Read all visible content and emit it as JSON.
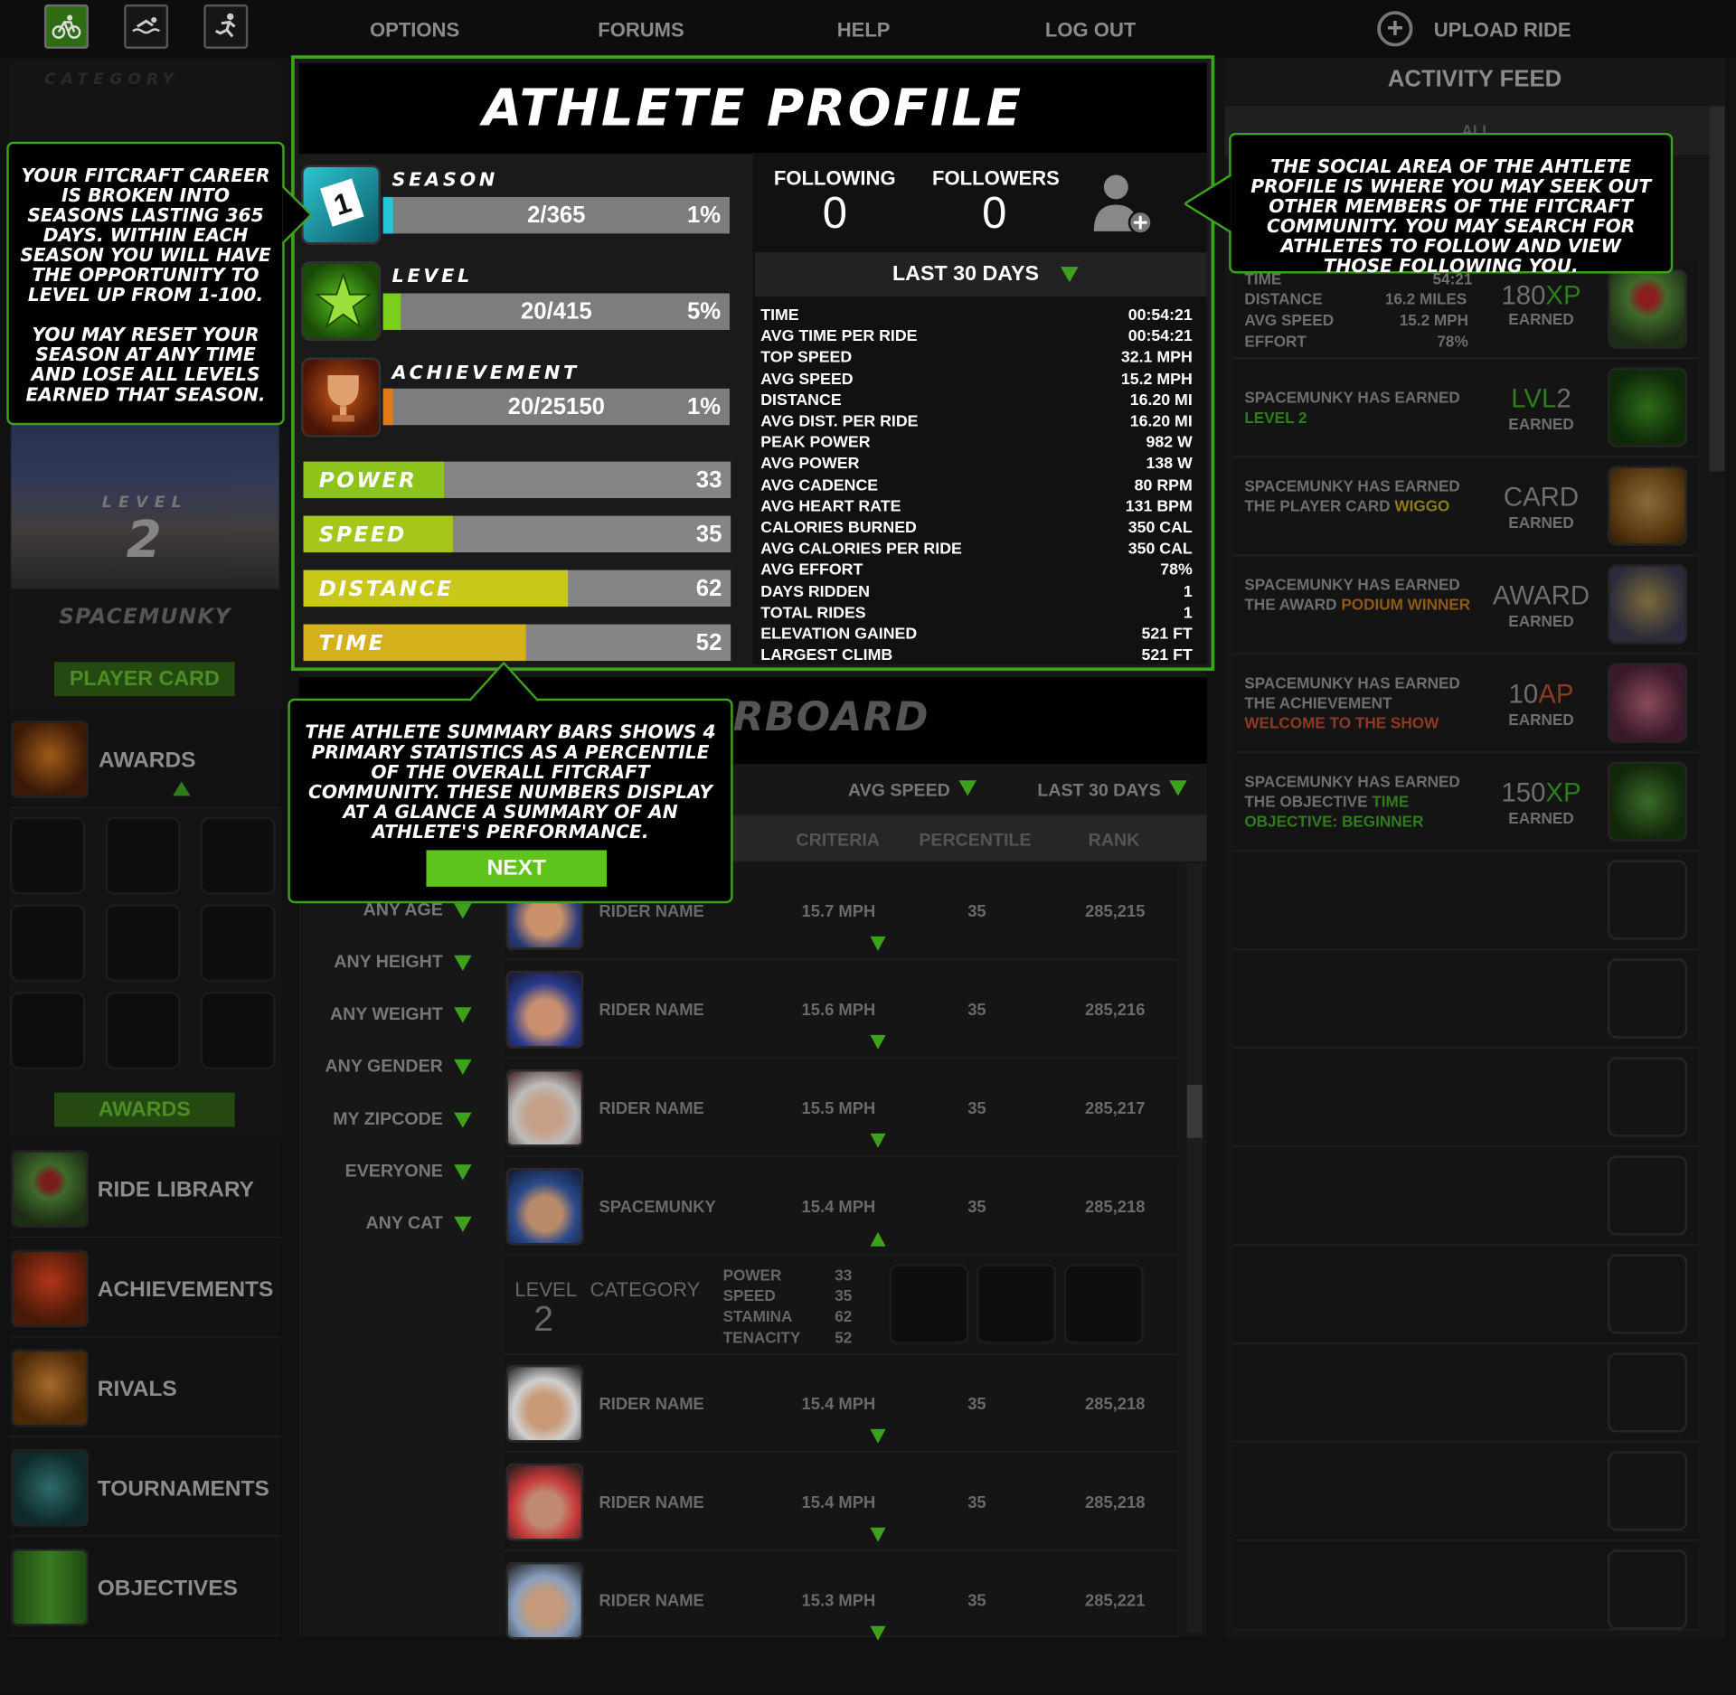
{
  "nav": {
    "options": "OPTIONS",
    "forums": "FORUMS",
    "help": "HELP",
    "logout": "LOG OUT",
    "upload": "UPLOAD RIDE"
  },
  "sidebar": {
    "category_label": "CATEGORY",
    "level_label": "LEVEL",
    "level_value": "2",
    "username": "SPACEMUNKY",
    "player_card_button": "PLAYER CARD",
    "awards_label": "AWARDS",
    "awards_button": "AWARDS",
    "items": [
      {
        "label": "RIDE LIBRARY"
      },
      {
        "label": "ACHIEVEMENTS"
      },
      {
        "label": "RIVALS"
      },
      {
        "label": "TOURNAMENTS"
      },
      {
        "label": "OBJECTIVES"
      }
    ]
  },
  "profile": {
    "title": "ATHLETE PROFILE",
    "season": {
      "label": "SEASON",
      "value": "2/365",
      "pct": "1%",
      "fraction": 0.01,
      "color": "#26c4d8"
    },
    "level": {
      "label": "LEVEL",
      "value": "20/415",
      "pct": "5%",
      "fraction": 0.05,
      "color": "#7bcf1c"
    },
    "achievement": {
      "label": "ACHIEVEMENT",
      "value": "20/25150",
      "pct": "1%",
      "fraction": 0.01,
      "color": "#e07a15"
    },
    "stats": [
      {
        "label": "POWER",
        "value": "33",
        "fraction": 0.33,
        "color": "#8cc41c"
      },
      {
        "label": "SPEED",
        "value": "35",
        "fraction": 0.35,
        "color": "#a6c61a"
      },
      {
        "label": "DISTANCE",
        "value": "62",
        "fraction": 0.62,
        "color": "#c8c81a"
      },
      {
        "label": "TIME",
        "value": "52",
        "fraction": 0.52,
        "color": "#d4b01a"
      }
    ],
    "following_label": "FOLLOWING",
    "following_value": "0",
    "followers_label": "FOLLOWERS",
    "followers_value": "0",
    "period": "LAST 30 DAYS",
    "details": [
      {
        "k": "TIME",
        "v": "00:54:21"
      },
      {
        "k": "AVG TIME PER RIDE",
        "v": "00:54:21"
      },
      {
        "k": "TOP SPEED",
        "v": "32.1 MPH"
      },
      {
        "k": "AVG SPEED",
        "v": "15.2 MPH"
      },
      {
        "k": "DISTANCE",
        "v": "16.20 MI"
      },
      {
        "k": "AVG DIST. PER RIDE",
        "v": "16.20 MI"
      },
      {
        "k": "PEAK POWER",
        "v": "982 W"
      },
      {
        "k": "AVG POWER",
        "v": "138 W"
      },
      {
        "k": "AVG CADENCE",
        "v": "80 RPM"
      },
      {
        "k": "AVG HEART RATE",
        "v": "131 BPM"
      },
      {
        "k": "CALORIES BURNED",
        "v": "350 CAL"
      },
      {
        "k": "AVG CALORIES PER RIDE",
        "v": "350 CAL"
      },
      {
        "k": "AVG EFFORT",
        "v": "78%"
      },
      {
        "k": "DAYS RIDDEN",
        "v": "1"
      },
      {
        "k": "TOTAL RIDES",
        "v": "1"
      },
      {
        "k": "ELEVATION GAINED",
        "v": "521 FT"
      },
      {
        "k": "LARGEST CLIMB",
        "v": "521 FT"
      }
    ]
  },
  "callouts": {
    "season": "YOUR FITCRAFT CAREER IS BROKEN INTO SEASONS LASTING 365 DAYS. WITHIN EACH SEASON YOU WILL HAVE THE OPPORTUNITY TO LEVEL UP FROM 1-100.",
    "season2": "YOU MAY RESET YOUR SEASON AT ANY TIME AND LOSE ALL LEVELS EARNED THAT SEASON.",
    "social": "THE SOCIAL AREA OF THE AHTLETE PROFILE IS WHERE YOU MAY SEEK OUT OTHER MEMBERS OF THE FITCRAFT COMMUNITY. YOU MAY SEARCH FOR ATHLETES TO FOLLOW AND VIEW THOSE FOLLOWING YOU.",
    "summary": "THE ATHLETE SUMMARY BARS SHOWS 4 PRIMARY STATISTICS AS A PERCENTILE OF THE OVERALL FITCRAFT COMMUNITY. THESE NUMBERS DISPLAY AT A GLANCE A SUMMARY OF AN ATHLETE'S PERFORMANCE.",
    "next": "NEXT"
  },
  "leaderboard": {
    "title_fragment": "RBOARD",
    "metric": "AVG SPEED",
    "period": "LAST 30 DAYS",
    "col_criteria": "CRITERIA",
    "col_percentile": "PERCENTILE",
    "col_rank": "RANK",
    "filters": [
      "ANY AGE",
      "ANY HEIGHT",
      "ANY WEIGHT",
      "ANY GENDER",
      "MY ZIPCODE",
      "EVERYONE",
      "ANY CAT"
    ],
    "rows": [
      {
        "name": "RIDER NAME",
        "speed": "15.7 MPH",
        "pct": "35",
        "rank": "285,215"
      },
      {
        "name": "RIDER NAME",
        "speed": "15.6 MPH",
        "pct": "35",
        "rank": "285,216"
      },
      {
        "name": "RIDER NAME",
        "speed": "15.5 MPH",
        "pct": "35",
        "rank": "285,217"
      },
      {
        "name": "SPACEMUNKY",
        "speed": "15.4 MPH",
        "pct": "35",
        "rank": "285,218"
      },
      {
        "name": "RIDER NAME",
        "speed": "15.4 MPH",
        "pct": "35",
        "rank": "285,218"
      },
      {
        "name": "RIDER NAME",
        "speed": "15.4 MPH",
        "pct": "35",
        "rank": "285,218"
      },
      {
        "name": "RIDER NAME",
        "speed": "15.3 MPH",
        "pct": "35",
        "rank": "285,221"
      }
    ],
    "expanded": {
      "level_label": "LEVEL",
      "level_value": "2",
      "category_label": "CATEGORY",
      "stats": [
        {
          "k": "POWER",
          "v": "33"
        },
        {
          "k": "SPEED",
          "v": "35"
        },
        {
          "k": "STAMINA",
          "v": "62"
        },
        {
          "k": "TENACITY",
          "v": "52"
        }
      ]
    }
  },
  "feed": {
    "title": "ACTIVITY FEED",
    "filter": "ALL",
    "first": {
      "time_label": "TIME",
      "time": "54:21",
      "dist_label": "DISTANCE",
      "dist": "16.2 MILES",
      "spd_label": "AVG SPEED",
      "spd": "15.2 MPH",
      "eff_label": "EFFORT",
      "eff": "78%",
      "amount": "180",
      "unit": "XP",
      "earned": "EARNED"
    },
    "items": [
      {
        "l1": "SPACEMUNKY HAS EARNED",
        "l2": "LEVEL 2",
        "l3": "",
        "amount": "LVL",
        "unit": "2",
        "earned": "EARNED"
      },
      {
        "l1": "SPACEMUNKY HAS EARNED",
        "l2": "THE PLAYER CARD",
        "l3": "WIGGO",
        "amount": "CARD",
        "unit": "",
        "earned": "EARNED"
      },
      {
        "l1": "SPACEMUNKY HAS EARNED",
        "l2": "THE AWARD",
        "l3": "PODIUM WINNER",
        "amount": "AWARD",
        "unit": "",
        "earned": "EARNED"
      },
      {
        "l1": "SPACEMUNKY HAS EARNED",
        "l2": "THE ACHIEVEMENT",
        "l3": "WELCOME TO THE SHOW",
        "amount": "10",
        "unit": "AP",
        "earned": "EARNED"
      },
      {
        "l1": "SPACEMUNKY HAS EARNED",
        "l2": "THE OBJECTIVE",
        "l3": "TIME OBJECTIVE: BEGINNER",
        "amount": "150",
        "unit": "XP",
        "earned": "EARNED"
      }
    ]
  }
}
